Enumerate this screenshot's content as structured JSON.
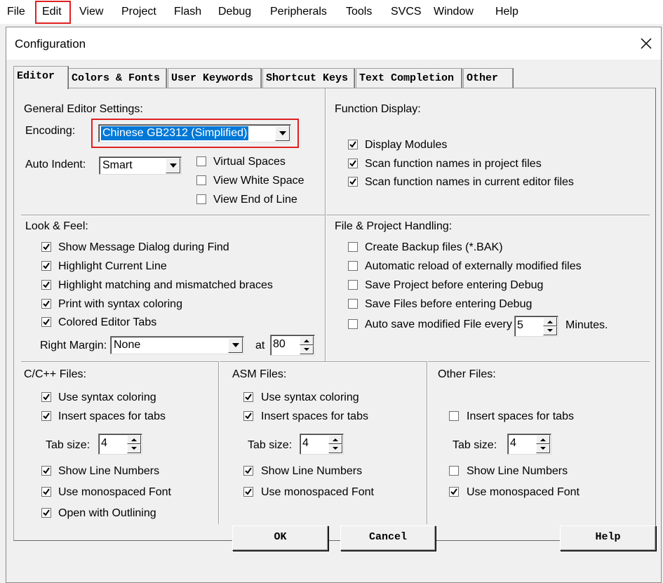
{
  "menu": [
    "File",
    "Edit",
    "View",
    "Project",
    "Flash",
    "Debug",
    "Peripherals",
    "Tools",
    "SVCS",
    "Window",
    "Help"
  ],
  "dialog": {
    "title": "Configuration",
    "tabs": [
      "Editor",
      "Colors & Fonts",
      "User Keywords",
      "Shortcut Keys",
      "Text Completion",
      "Other"
    ],
    "active_tab": "Editor",
    "buttons": {
      "ok": "OK",
      "cancel": "Cancel",
      "help": "Help"
    }
  },
  "general": {
    "heading": "General Editor Settings:",
    "encoding_label": "Encoding:",
    "encoding_value": "Chinese GB2312 (Simplified)",
    "auto_indent_label": "Auto Indent:",
    "auto_indent_value": "Smart",
    "options": [
      {
        "label": "Virtual Spaces",
        "checked": false
      },
      {
        "label": "View White Space",
        "checked": false
      },
      {
        "label": "View End of Line",
        "checked": false
      }
    ]
  },
  "function_display": {
    "heading": "Function Display:",
    "options": [
      {
        "label": "Display Modules",
        "checked": true
      },
      {
        "label": "Scan function names in project files",
        "checked": true
      },
      {
        "label": "Scan function names in current editor files",
        "checked": true
      }
    ]
  },
  "look_feel": {
    "heading": "Look & Feel:",
    "options": [
      {
        "label": "Show Message Dialog during Find",
        "checked": true
      },
      {
        "label": "Highlight Current Line",
        "checked": true
      },
      {
        "label": "Highlight matching and mismatched braces",
        "checked": true
      },
      {
        "label": "Print with syntax coloring",
        "checked": true
      },
      {
        "label": "Colored Editor Tabs",
        "checked": true
      }
    ],
    "right_margin_label": "Right Margin:",
    "right_margin_value": "None",
    "at_label": "at",
    "at_value": "80"
  },
  "file_project": {
    "heading": "File & Project Handling:",
    "options": [
      {
        "label": "Create Backup files (*.BAK)",
        "checked": false
      },
      {
        "label": "Automatic reload of externally modified files",
        "checked": false
      },
      {
        "label": "Save Project before entering Debug",
        "checked": false
      },
      {
        "label": "Save Files before entering Debug",
        "checked": false
      }
    ],
    "autosave_label": "Auto save modified File every",
    "autosave_checked": false,
    "autosave_value": "5",
    "minutes_label": "Minutes."
  },
  "c_files": {
    "heading": "C/C++ Files:",
    "syntax": {
      "label": "Use syntax coloring",
      "checked": true
    },
    "spaces": {
      "label": "Insert spaces for tabs",
      "checked": true
    },
    "tab_size_label": "Tab size:",
    "tab_size": "4",
    "line_numbers": {
      "label": "Show Line Numbers",
      "checked": true
    },
    "mono": {
      "label": "Use monospaced Font",
      "checked": true
    },
    "outlining": {
      "label": "Open with Outlining",
      "checked": true
    }
  },
  "asm_files": {
    "heading": "ASM Files:",
    "syntax": {
      "label": "Use syntax coloring",
      "checked": true
    },
    "spaces": {
      "label": "Insert spaces for tabs",
      "checked": true
    },
    "tab_size_label": "Tab size:",
    "tab_size": "4",
    "line_numbers": {
      "label": "Show Line Numbers",
      "checked": true
    },
    "mono": {
      "label": "Use monospaced Font",
      "checked": true
    }
  },
  "other_files": {
    "heading": "Other Files:",
    "spaces": {
      "label": "Insert spaces for tabs",
      "checked": false
    },
    "tab_size_label": "Tab size:",
    "tab_size": "4",
    "line_numbers": {
      "label": "Show Line Numbers",
      "checked": false
    },
    "mono": {
      "label": "Use monospaced Font",
      "checked": true
    }
  },
  "colors": {
    "highlight": "#e02020",
    "selection": "#0078d7"
  }
}
